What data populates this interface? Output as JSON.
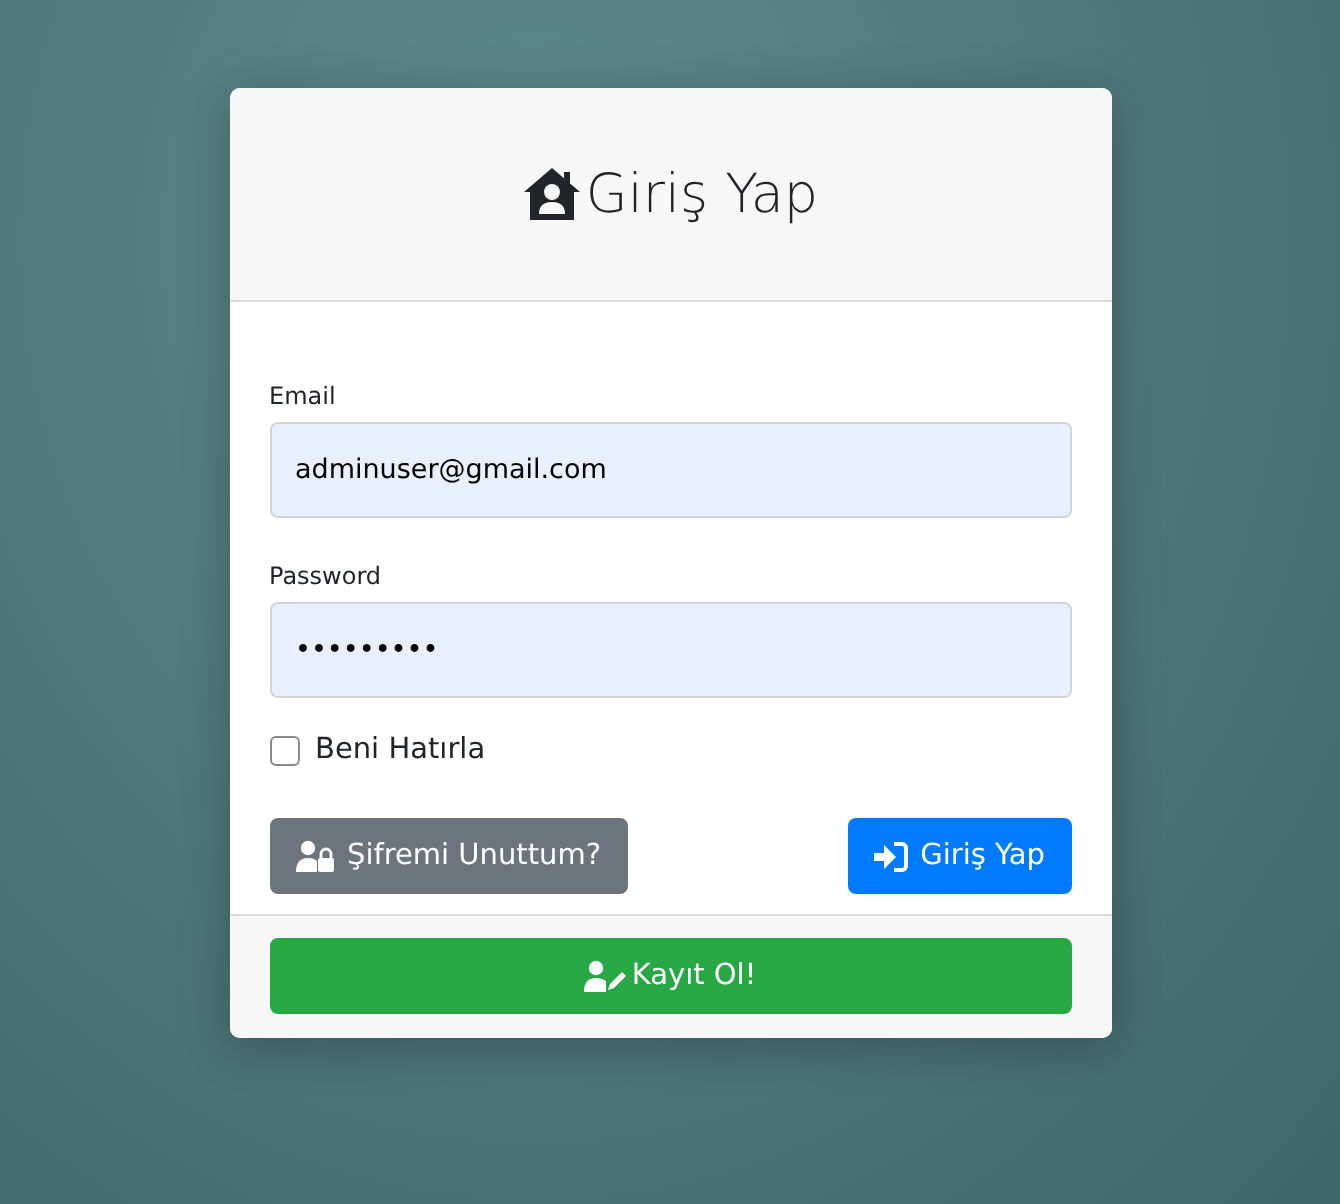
{
  "header": {
    "title": "Giriş Yap"
  },
  "fields": [
    {
      "label": "Email",
      "value": "adminuser@gmail.com"
    },
    {
      "label": "Password",
      "value": "•••••••••"
    }
  ],
  "remember": {
    "label": "Beni Hatırla",
    "checked": false
  },
  "buttons": [
    {
      "kind": "forgot",
      "label": "Şifremi Unuttum?"
    },
    {
      "kind": "login",
      "label": "Giriş Yap"
    }
  ],
  "register": {
    "label": "Kayıt Ol!"
  }
}
